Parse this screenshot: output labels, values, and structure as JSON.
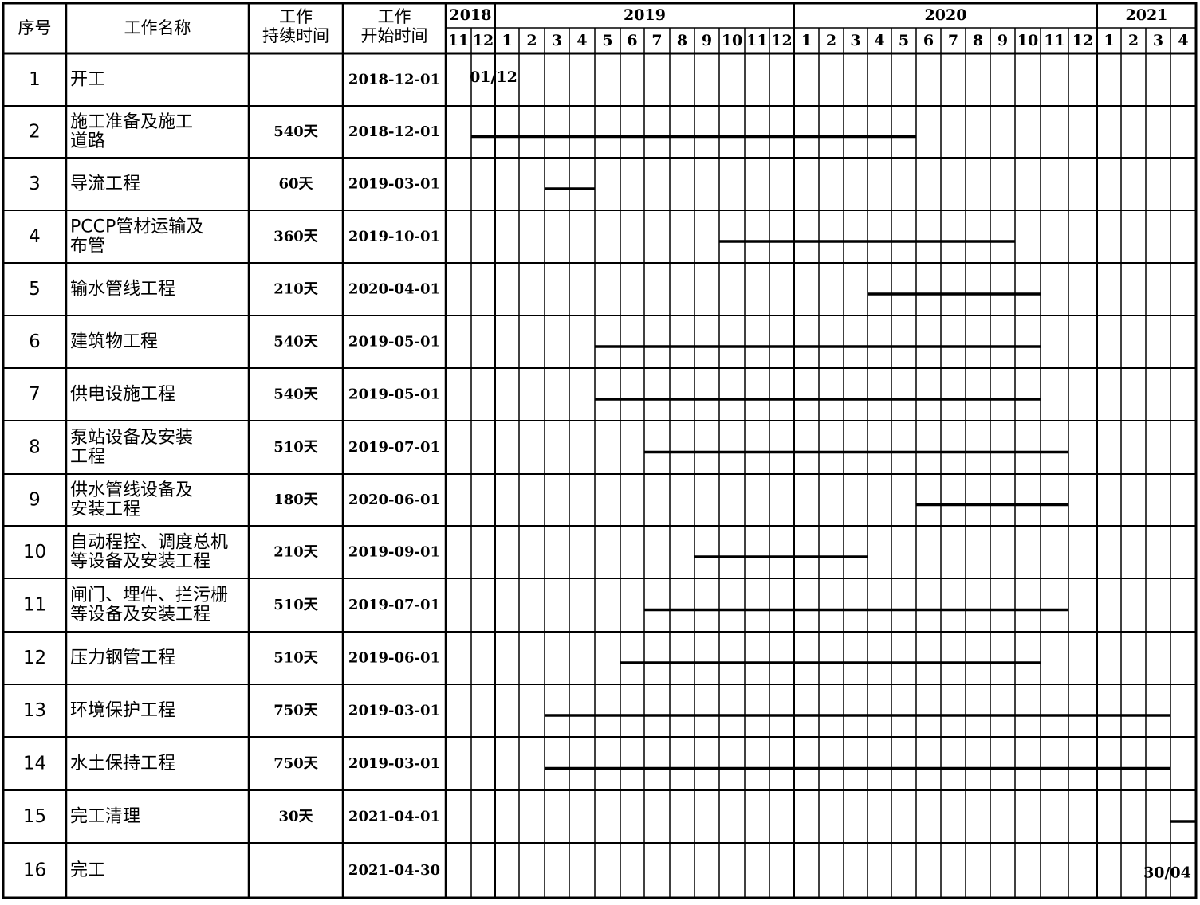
{
  "header": {
    "seq": "序号",
    "name": "工作名称",
    "duration": [
      "工作",
      "持续时间"
    ],
    "start": [
      "工作",
      "开始时间"
    ]
  },
  "years": [
    "2018",
    "2019",
    "2020",
    "2021"
  ],
  "months": [
    "11",
    "12",
    "1",
    "2",
    "3",
    "4",
    "5",
    "6",
    "7",
    "8",
    "9",
    "10",
    "11",
    "12",
    "1",
    "2",
    "3",
    "4",
    "5",
    "6",
    "7",
    "8",
    "9",
    "10",
    "11",
    "12",
    "1",
    "2",
    "3",
    "4"
  ],
  "chart_data": {
    "type": "gantt",
    "x_axis": {
      "start_month": "2018-11",
      "end_month": "2021-04"
    },
    "milestone_marks": [
      "01/12",
      "30/04"
    ],
    "tasks": [
      {
        "no": "1",
        "name": [
          "开工"
        ],
        "duration": "",
        "start": "2018-12-01",
        "bar": null,
        "mark": "01/12"
      },
      {
        "no": "2",
        "name": [
          "施工准备及施工",
          "道路"
        ],
        "duration": "540天",
        "start": "2018-12-01",
        "bar": [
          1,
          19
        ]
      },
      {
        "no": "3",
        "name": [
          "导流工程"
        ],
        "duration": "60天",
        "start": "2019-03-01",
        "bar": [
          4,
          6
        ]
      },
      {
        "no": "4",
        "name": [
          "PCCP管材运输及",
          "布管"
        ],
        "duration": "360天",
        "start": "2019-10-01",
        "bar": [
          11,
          23
        ]
      },
      {
        "no": "5",
        "name": [
          "输水管线工程"
        ],
        "duration": "210天",
        "start": "2020-04-01",
        "bar": [
          17,
          24
        ]
      },
      {
        "no": "6",
        "name": [
          "建筑物工程"
        ],
        "duration": "540天",
        "start": "2019-05-01",
        "bar": [
          6,
          24
        ]
      },
      {
        "no": "7",
        "name": [
          "供电设施工程"
        ],
        "duration": "540天",
        "start": "2019-05-01",
        "bar": [
          6,
          24
        ]
      },
      {
        "no": "8",
        "name": [
          "泵站设备及安装",
          "工程"
        ],
        "duration": "510天",
        "start": "2019-07-01",
        "bar": [
          8,
          25
        ]
      },
      {
        "no": "9",
        "name": [
          "供水管线设备及",
          "安装工程"
        ],
        "duration": "180天",
        "start": "2020-06-01",
        "bar": [
          19,
          25
        ]
      },
      {
        "no": "10",
        "name": [
          "自动程控、调度总机",
          "等设备及安装工程"
        ],
        "duration": "210天",
        "start": "2019-09-01",
        "bar": [
          10,
          17
        ]
      },
      {
        "no": "11",
        "name": [
          "闸门、埋件、拦污栅",
          "等设备及安装工程"
        ],
        "duration": "510天",
        "start": "2019-07-01",
        "bar": [
          8,
          25
        ]
      },
      {
        "no": "12",
        "name": [
          "压力钢管工程"
        ],
        "duration": "510天",
        "start": "2019-06-01",
        "bar": [
          7,
          24
        ]
      },
      {
        "no": "13",
        "name": [
          "环境保护工程"
        ],
        "duration": "750天",
        "start": "2019-03-01",
        "bar": [
          4,
          29
        ]
      },
      {
        "no": "14",
        "name": [
          "水土保持工程"
        ],
        "duration": "750天",
        "start": "2019-03-01",
        "bar": [
          4,
          29
        ]
      },
      {
        "no": "15",
        "name": [
          "完工清理"
        ],
        "duration": "30天",
        "start": "2021-04-01",
        "bar": [
          29,
          30
        ]
      },
      {
        "no": "16",
        "name": [
          "完工"
        ],
        "duration": "",
        "start": "2021-04-30",
        "bar": null,
        "mark": "30/04"
      }
    ]
  }
}
